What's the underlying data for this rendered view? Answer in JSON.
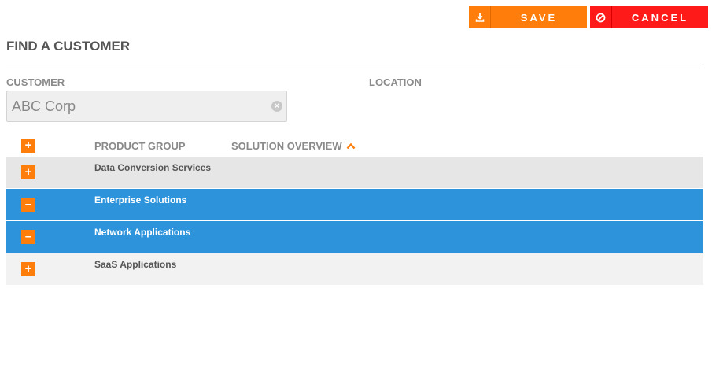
{
  "toolbar": {
    "save_label": "SAVE",
    "save_icon": "download-icon",
    "cancel_label": "CANCEL",
    "cancel_icon": "ban-icon",
    "save_color": "#ff7d0a",
    "cancel_color": "#ff1a1a"
  },
  "page": {
    "title": "FIND A CUSTOMER"
  },
  "filters": {
    "customer_label": "CUSTOMER",
    "customer_value": "ABC Corp",
    "location_label": "LOCATION"
  },
  "table": {
    "headers": {
      "product_group": "PRODUCT GROUP",
      "solution_overview": "SOLUTION OVERVIEW"
    },
    "sort": {
      "column": "solution_overview",
      "direction": "ascending"
    },
    "rows": [
      {
        "name": "Data Conversion Services",
        "expanded": false,
        "selected": false
      },
      {
        "name": "Enterprise Solutions",
        "expanded": true,
        "selected": true
      },
      {
        "name": "Network Applications",
        "expanded": true,
        "selected": true
      },
      {
        "name": "SaaS Applications",
        "expanded": false,
        "selected": false
      }
    ],
    "selected_color": "#2d93db"
  }
}
